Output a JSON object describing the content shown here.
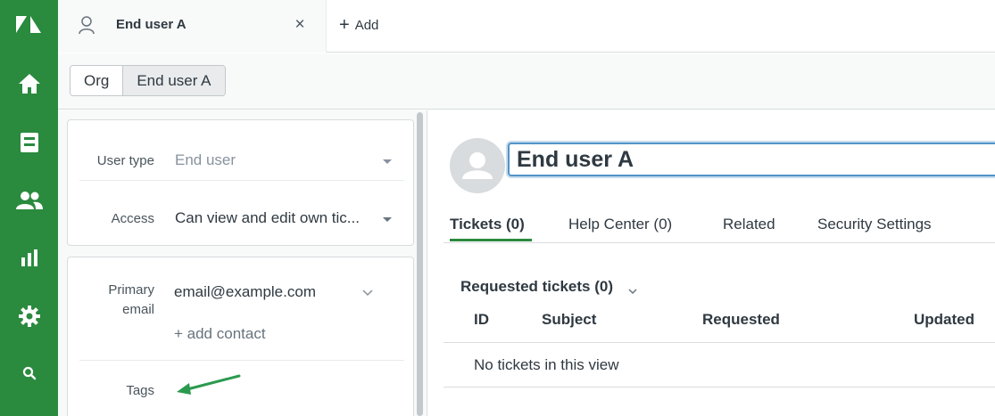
{
  "nav": {
    "icons": [
      "zendesk-logo-icon",
      "home-icon",
      "views-icon",
      "customers-icon",
      "reporting-icon",
      "admin-gear-icon",
      "search-icon"
    ]
  },
  "topbar": {
    "active_tab_title": "End user A",
    "close_glyph": "×",
    "add_glyph": "+",
    "add_label": "Add"
  },
  "breadcrumb": {
    "items": [
      {
        "label": "Org"
      },
      {
        "label": "End user A"
      }
    ]
  },
  "user_fields": {
    "user_type_label": "User type",
    "user_type_value": "End user",
    "access_label": "Access",
    "access_value": "Can view and edit own tic...",
    "primary_email_label_line1": "Primary",
    "primary_email_label_line2": "email",
    "primary_email_value": "email@example.com",
    "add_contact_label": "+ add contact",
    "tags_label": "Tags"
  },
  "annotation": {
    "arrow_color": "#2a9a4e"
  },
  "user": {
    "name": "End user A"
  },
  "tabs": [
    {
      "label": "Tickets (0)",
      "active": true
    },
    {
      "label": "Help Center (0)",
      "active": false
    },
    {
      "label": "Related",
      "active": false
    },
    {
      "label": "Security Settings",
      "active": false
    }
  ],
  "tickets": {
    "section_title": "Requested tickets (0)",
    "columns": [
      "ID",
      "Subject",
      "Requested",
      "Updated"
    ],
    "empty_message": "No tickets in this view"
  },
  "colors": {
    "brand_green": "#2a8a3e",
    "focus_blue": "#5293c7"
  }
}
